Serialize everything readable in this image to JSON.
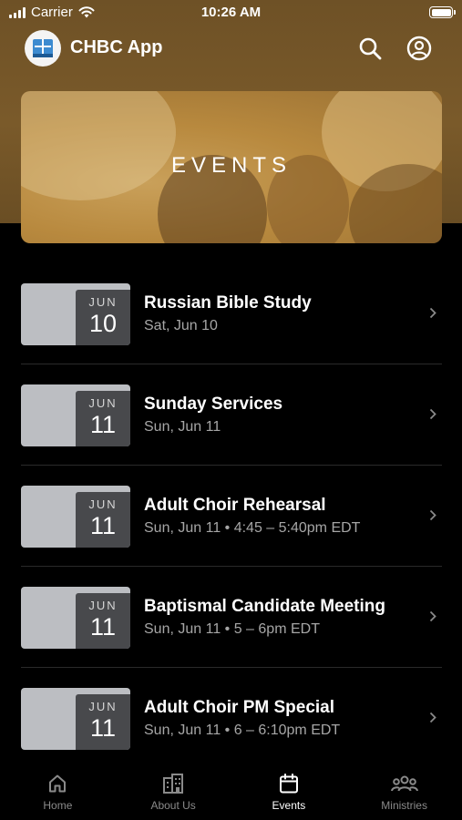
{
  "status_bar": {
    "carrier": "Carrier",
    "time": "10:26 AM"
  },
  "app_bar": {
    "title": "CHBC App",
    "logo_icon": "church-book-logo-icon",
    "search_icon": "search-icon",
    "account_icon": "account-circle-icon"
  },
  "hero": {
    "label": "EVENTS"
  },
  "events": [
    {
      "month": "JUN",
      "day": "10",
      "title": "Russian Bible Study",
      "subtitle": "Sat, Jun 10"
    },
    {
      "month": "JUN",
      "day": "11",
      "title": "Sunday Services",
      "subtitle": "Sun, Jun 11"
    },
    {
      "month": "JUN",
      "day": "11",
      "title": "Adult Choir Rehearsal",
      "subtitle": "Sun, Jun 11 • 4:45 – 5:40pm EDT"
    },
    {
      "month": "JUN",
      "day": "11",
      "title": "Baptismal Candidate Meeting",
      "subtitle": "Sun, Jun 11 • 5 – 6pm EDT"
    },
    {
      "month": "JUN",
      "day": "11",
      "title": "Adult Choir PM Special",
      "subtitle": "Sun, Jun 11 • 6 – 6:10pm EDT"
    }
  ],
  "tabs": [
    {
      "label": "Home",
      "icon": "home-icon",
      "active": false
    },
    {
      "label": "About Us",
      "icon": "building-icon",
      "active": false
    },
    {
      "label": "Events",
      "icon": "calendar-icon",
      "active": true
    },
    {
      "label": "Ministries",
      "icon": "people-group-icon",
      "active": false
    }
  ],
  "colors": {
    "header_brown": "#7a5a2a",
    "background": "#000000",
    "tile_gray": "#bcbec2",
    "date_box": "#48494c"
  }
}
